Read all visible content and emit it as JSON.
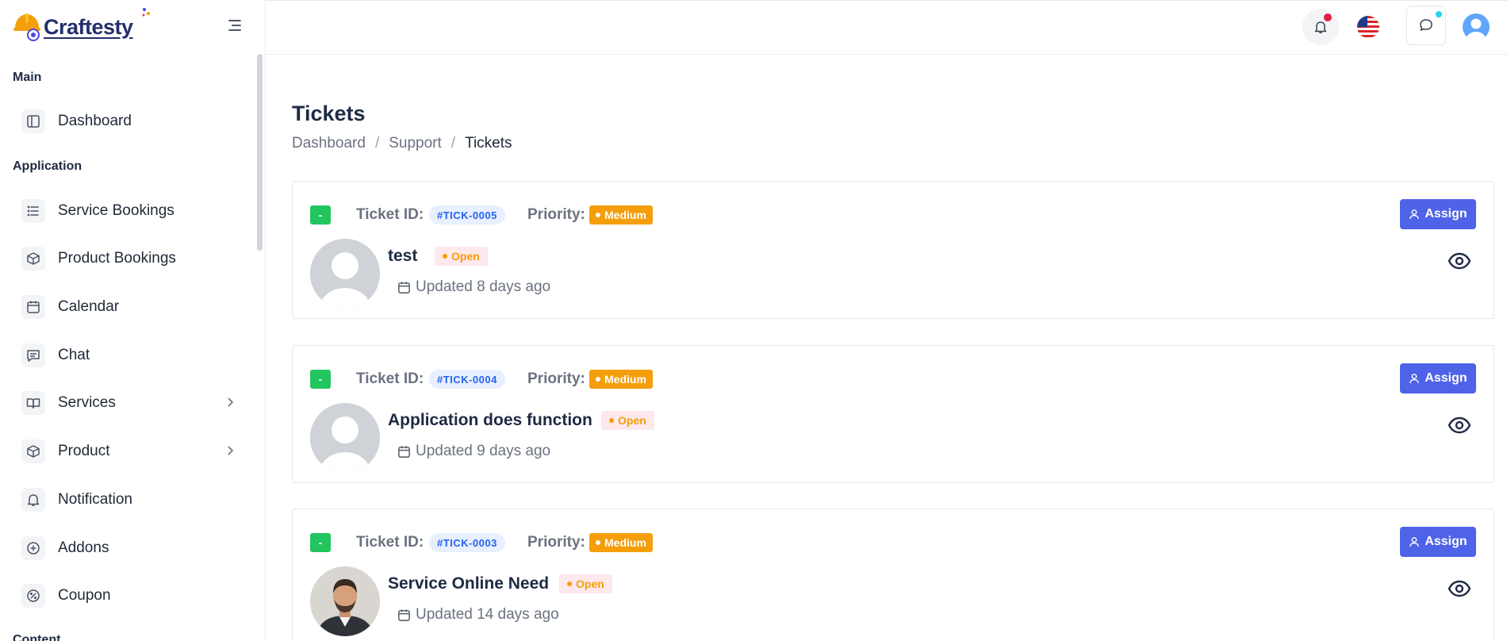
{
  "brand": {
    "name": "Craftesty"
  },
  "sidebar": {
    "sections": [
      {
        "title": "Main"
      },
      {
        "title": "Application"
      },
      {
        "title": "Content"
      }
    ],
    "items": [
      {
        "label": "Dashboard",
        "icon": "layout-icon"
      },
      {
        "label": "Service Bookings",
        "icon": "list-icon"
      },
      {
        "label": "Product Bookings",
        "icon": "box-icon"
      },
      {
        "label": "Calendar",
        "icon": "calendar-icon"
      },
      {
        "label": "Chat",
        "icon": "message-icon"
      },
      {
        "label": "Services",
        "icon": "book-icon",
        "has_submenu": true
      },
      {
        "label": "Product",
        "icon": "box-icon",
        "has_submenu": true
      },
      {
        "label": "Notification",
        "icon": "bell-icon"
      },
      {
        "label": "Addons",
        "icon": "plus-circle-icon"
      },
      {
        "label": "Coupon",
        "icon": "percent-icon"
      }
    ]
  },
  "header": {
    "icons": [
      "bell-icon",
      "us-flag-icon",
      "chat-icon",
      "user-avatar"
    ]
  },
  "page": {
    "title": "Tickets",
    "breadcrumb": [
      "Dashboard",
      "Support",
      "Tickets"
    ]
  },
  "ticket_labels": {
    "ticket_id": "Ticket ID:",
    "priority": "Priority:",
    "assign": "Assign",
    "status_marker": "-"
  },
  "tickets": [
    {
      "id": "#TICK-0005",
      "priority": "Medium",
      "title": "test",
      "status": "Open",
      "updated": "Updated 8 days ago",
      "avatar": "placeholder"
    },
    {
      "id": "#TICK-0004",
      "priority": "Medium",
      "title": "Application does function",
      "status": "Open",
      "updated": "Updated 9 days ago",
      "avatar": "placeholder"
    },
    {
      "id": "#TICK-0003",
      "priority": "Medium",
      "title": "Service Online Need",
      "status": "Open",
      "updated": "Updated 14 days ago",
      "avatar": "photo"
    }
  ],
  "colors": {
    "accent": "#4f63e8",
    "priority_medium": "#f59e0b",
    "status_green": "#22c55e",
    "id_badge": "#2563eb"
  }
}
